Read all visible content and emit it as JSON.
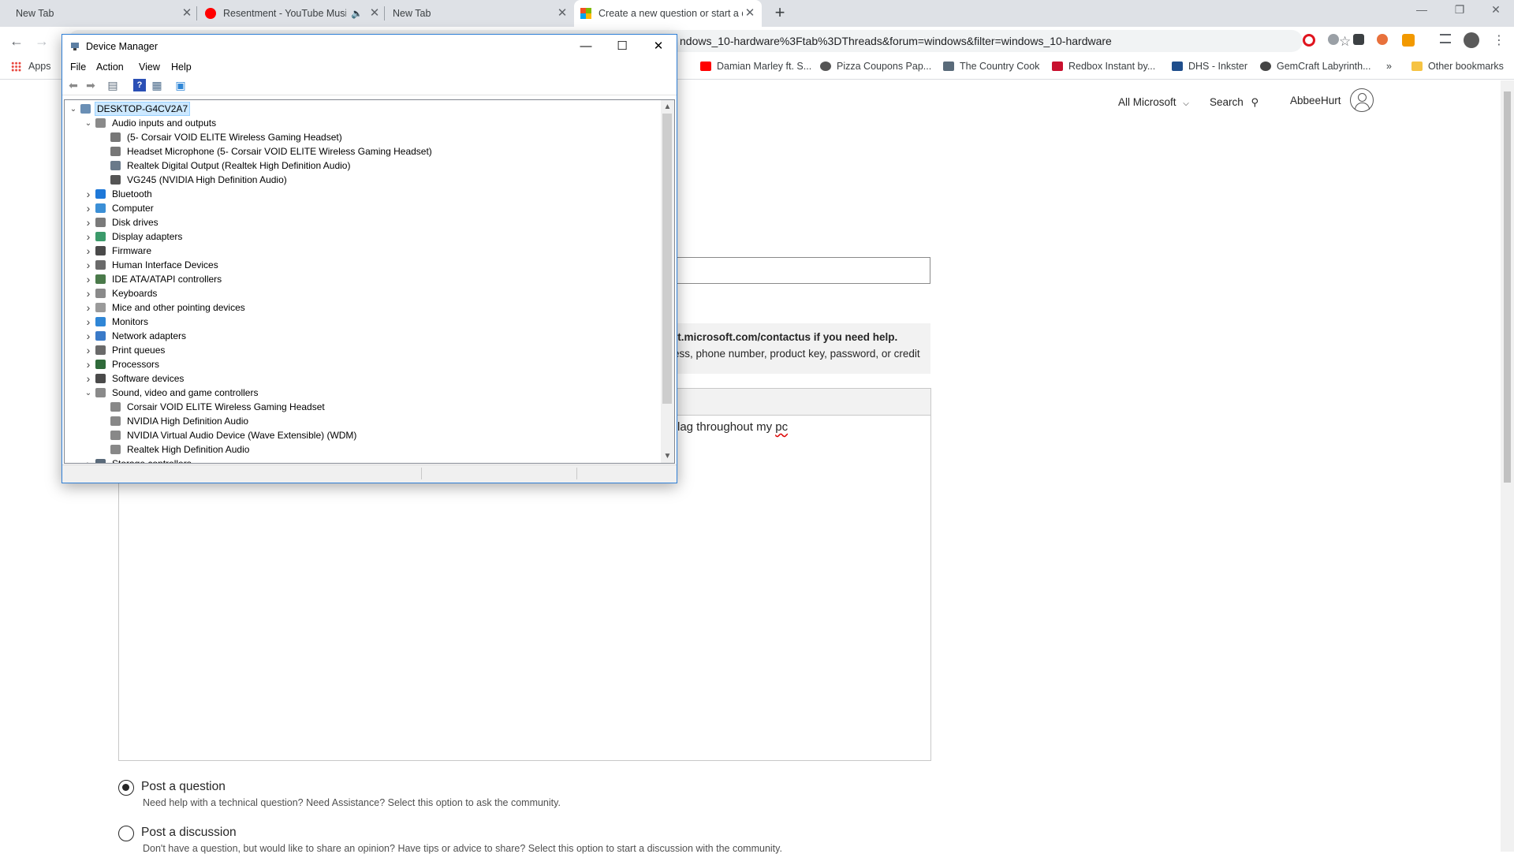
{
  "browser": {
    "tabs": [
      {
        "title": "New Tab"
      },
      {
        "title": "Resentment - YouTube Music"
      },
      {
        "title": "New Tab"
      },
      {
        "title": "Create a new question or start a discussion"
      }
    ],
    "url": "ndows_10-hardware%3Ftab%3DThreads&forum=windows&filter=windows_10-hardware",
    "bookmarks": [
      {
        "label": "Apps",
        "color": "#e8453c"
      },
      {
        "label": "Damian Marley ft. S...",
        "color": "#ff0000"
      },
      {
        "label": "Pizza Coupons Pap...",
        "color": "#555555"
      },
      {
        "label": "The Country Cook",
        "color": "#5a6b7a"
      },
      {
        "label": "Redbox Instant by...",
        "color": "#c8102e"
      },
      {
        "label": "DHS - Inkster",
        "color": "#1f4e8c"
      },
      {
        "label": "GemCraft Labyrinth...",
        "color": "#444444"
      }
    ],
    "bookmarks_more": "»",
    "other_bookmarks": "Other bookmarks"
  },
  "page": {
    "header": {
      "all_microsoft": "All Microsoft",
      "search": "Search",
      "user": "AbbeeHurt"
    },
    "notice": {
      "line1": "rt.microsoft.com/contactus if you need help.",
      "line2": "ess, phone number, product key, password, or credit"
    },
    "editor_text_a": "lag throughout my ",
    "editor_text_b": "pc",
    "post_question": {
      "label": "Post a question",
      "desc": "Need help with a technical question? Need Assistance? Select this option to ask the community."
    },
    "post_discussion": {
      "label": "Post a discussion",
      "desc": "Don't have a question, but would like to share an opinion? Have tips or advice to share? Select this option to start a discussion with the community."
    }
  },
  "device_manager": {
    "title": "Device Manager",
    "menu": [
      "File",
      "Action",
      "View",
      "Help"
    ],
    "tree": [
      {
        "label": "DESKTOP-G4CV2A7",
        "indent": 0,
        "chev": "v",
        "icon": "#6a8fb5"
      },
      {
        "label": "Audio inputs and outputs",
        "indent": 1,
        "chev": "v",
        "icon": "#8a8a8a"
      },
      {
        "label": "(5- Corsair VOID ELITE Wireless Gaming Headset)",
        "indent": 2,
        "chev": "",
        "icon": "#777777"
      },
      {
        "label": "Headset Microphone (5- Corsair VOID ELITE Wireless Gaming Headset)",
        "indent": 2,
        "chev": "",
        "icon": "#777777"
      },
      {
        "label": "Realtek Digital Output (Realtek High Definition Audio)",
        "indent": 2,
        "chev": "",
        "icon": "#6a7a8a"
      },
      {
        "label": "VG245 (NVIDIA High Definition Audio)",
        "indent": 2,
        "chev": "",
        "icon": "#555555"
      },
      {
        "label": "Bluetooth",
        "indent": 1,
        "chev": ">",
        "icon": "#1e78d8"
      },
      {
        "label": "Computer",
        "indent": 1,
        "chev": ">",
        "icon": "#3b8fd6"
      },
      {
        "label": "Disk drives",
        "indent": 1,
        "chev": ">",
        "icon": "#7a7a7a"
      },
      {
        "label": "Display adapters",
        "indent": 1,
        "chev": ">",
        "icon": "#3b9a6a"
      },
      {
        "label": "Firmware",
        "indent": 1,
        "chev": ">",
        "icon": "#4a4a4a"
      },
      {
        "label": "Human Interface Devices",
        "indent": 1,
        "chev": ">",
        "icon": "#6a6a6a"
      },
      {
        "label": "IDE ATA/ATAPI controllers",
        "indent": 1,
        "chev": ">",
        "icon": "#4a7a4a"
      },
      {
        "label": "Keyboards",
        "indent": 1,
        "chev": ">",
        "icon": "#8a8a8a"
      },
      {
        "label": "Mice and other pointing devices",
        "indent": 1,
        "chev": ">",
        "icon": "#9a9a9a"
      },
      {
        "label": "Monitors",
        "indent": 1,
        "chev": ">",
        "icon": "#2f86d6"
      },
      {
        "label": "Network adapters",
        "indent": 1,
        "chev": ">",
        "icon": "#3a7ac8"
      },
      {
        "label": "Print queues",
        "indent": 1,
        "chev": ">",
        "icon": "#6a6a6a"
      },
      {
        "label": "Processors",
        "indent": 1,
        "chev": ">",
        "icon": "#2f6a3a"
      },
      {
        "label": "Software devices",
        "indent": 1,
        "chev": ">",
        "icon": "#4a4a4a"
      },
      {
        "label": "Sound, video and game controllers",
        "indent": 1,
        "chev": "v",
        "icon": "#8a8a8a"
      },
      {
        "label": "Corsair VOID ELITE Wireless Gaming Headset",
        "indent": 2,
        "chev": "",
        "icon": "#888888"
      },
      {
        "label": "NVIDIA High Definition Audio",
        "indent": 2,
        "chev": "",
        "icon": "#888888"
      },
      {
        "label": "NVIDIA Virtual Audio Device (Wave Extensible) (WDM)",
        "indent": 2,
        "chev": "",
        "icon": "#888888"
      },
      {
        "label": "Realtek High Definition Audio",
        "indent": 2,
        "chev": "",
        "icon": "#888888"
      },
      {
        "label": "Storage controllers",
        "indent": 1,
        "chev": ">",
        "icon": "#5a6a7a"
      }
    ]
  }
}
